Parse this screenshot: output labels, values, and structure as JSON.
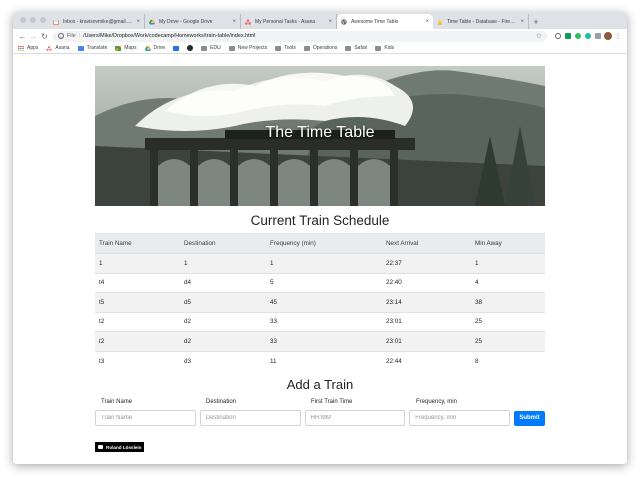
{
  "browser": {
    "tabs": [
      {
        "title": "Inbox - kravisovmike@gmail.com",
        "favicon": "gmail-icon",
        "active": false
      },
      {
        "title": "My Drive - Google Drive",
        "favicon": "drive-icon",
        "active": false
      },
      {
        "title": "My Personal Tasks - Asana",
        "favicon": "asana-icon",
        "active": false
      },
      {
        "title": "Awesome Time Table",
        "favicon": "globe-icon",
        "active": true
      },
      {
        "title": "Time Table - Database - Firebase",
        "favicon": "firebase-icon",
        "active": false
      }
    ],
    "address": {
      "scheme": "File",
      "path": "/Users/Mike/Dropbox/Work/codecamp/Homeworks/train-table/index.html"
    },
    "bookmarks": [
      {
        "label": "Apps",
        "icon": "apps-grid-icon"
      },
      {
        "label": "Asana",
        "icon": "asana-icon"
      },
      {
        "label": "Translate",
        "icon": "translate-icon"
      },
      {
        "label": "Maps",
        "icon": "maps-icon"
      },
      {
        "label": "Drive",
        "icon": "drive-icon"
      },
      {
        "label": "",
        "icon": "calendar-icon"
      },
      {
        "label": "",
        "icon": "github-icon"
      },
      {
        "label": "EDU",
        "icon": "folder-icon"
      },
      {
        "label": "New Projects",
        "icon": "folder-icon"
      },
      {
        "label": "Tools",
        "icon": "folder-icon"
      },
      {
        "label": "Operations",
        "icon": "folder-icon"
      },
      {
        "label": "Safari",
        "icon": "folder-icon"
      },
      {
        "label": "Kids",
        "icon": "folder-icon"
      }
    ],
    "colors": {
      "accent": "#007bff",
      "tabstrip": "#dee1e6"
    }
  },
  "hero": {
    "title": "The Time Table"
  },
  "schedule": {
    "title": "Current Train Schedule",
    "columns": [
      "Train Name",
      "Destination",
      "Frequency (min)",
      "Next Arrival",
      "Min Away"
    ],
    "rows": [
      [
        "1",
        "1",
        "1",
        "22:37",
        "1"
      ],
      [
        "t4",
        "d4",
        "5",
        "22:40",
        "4"
      ],
      [
        "t5",
        "d5",
        "45",
        "23:14",
        "38"
      ],
      [
        "t2",
        "d2",
        "33",
        "23:01",
        "25"
      ],
      [
        "t2",
        "d2",
        "33",
        "23:01",
        "25"
      ],
      [
        "t3",
        "d3",
        "11",
        "22:44",
        "8"
      ]
    ]
  },
  "add_train": {
    "title": "Add a Train",
    "fields": [
      {
        "label": "Train Name",
        "placeholder": "Train Name"
      },
      {
        "label": "Destination",
        "placeholder": "Destination"
      },
      {
        "label": "First Train Time",
        "placeholder": "HH:MM"
      },
      {
        "label": "Frequency, min",
        "placeholder": "Frequency, min"
      }
    ],
    "submit_label": "Submit"
  },
  "credit": {
    "label": "Roland Lösslein"
  }
}
